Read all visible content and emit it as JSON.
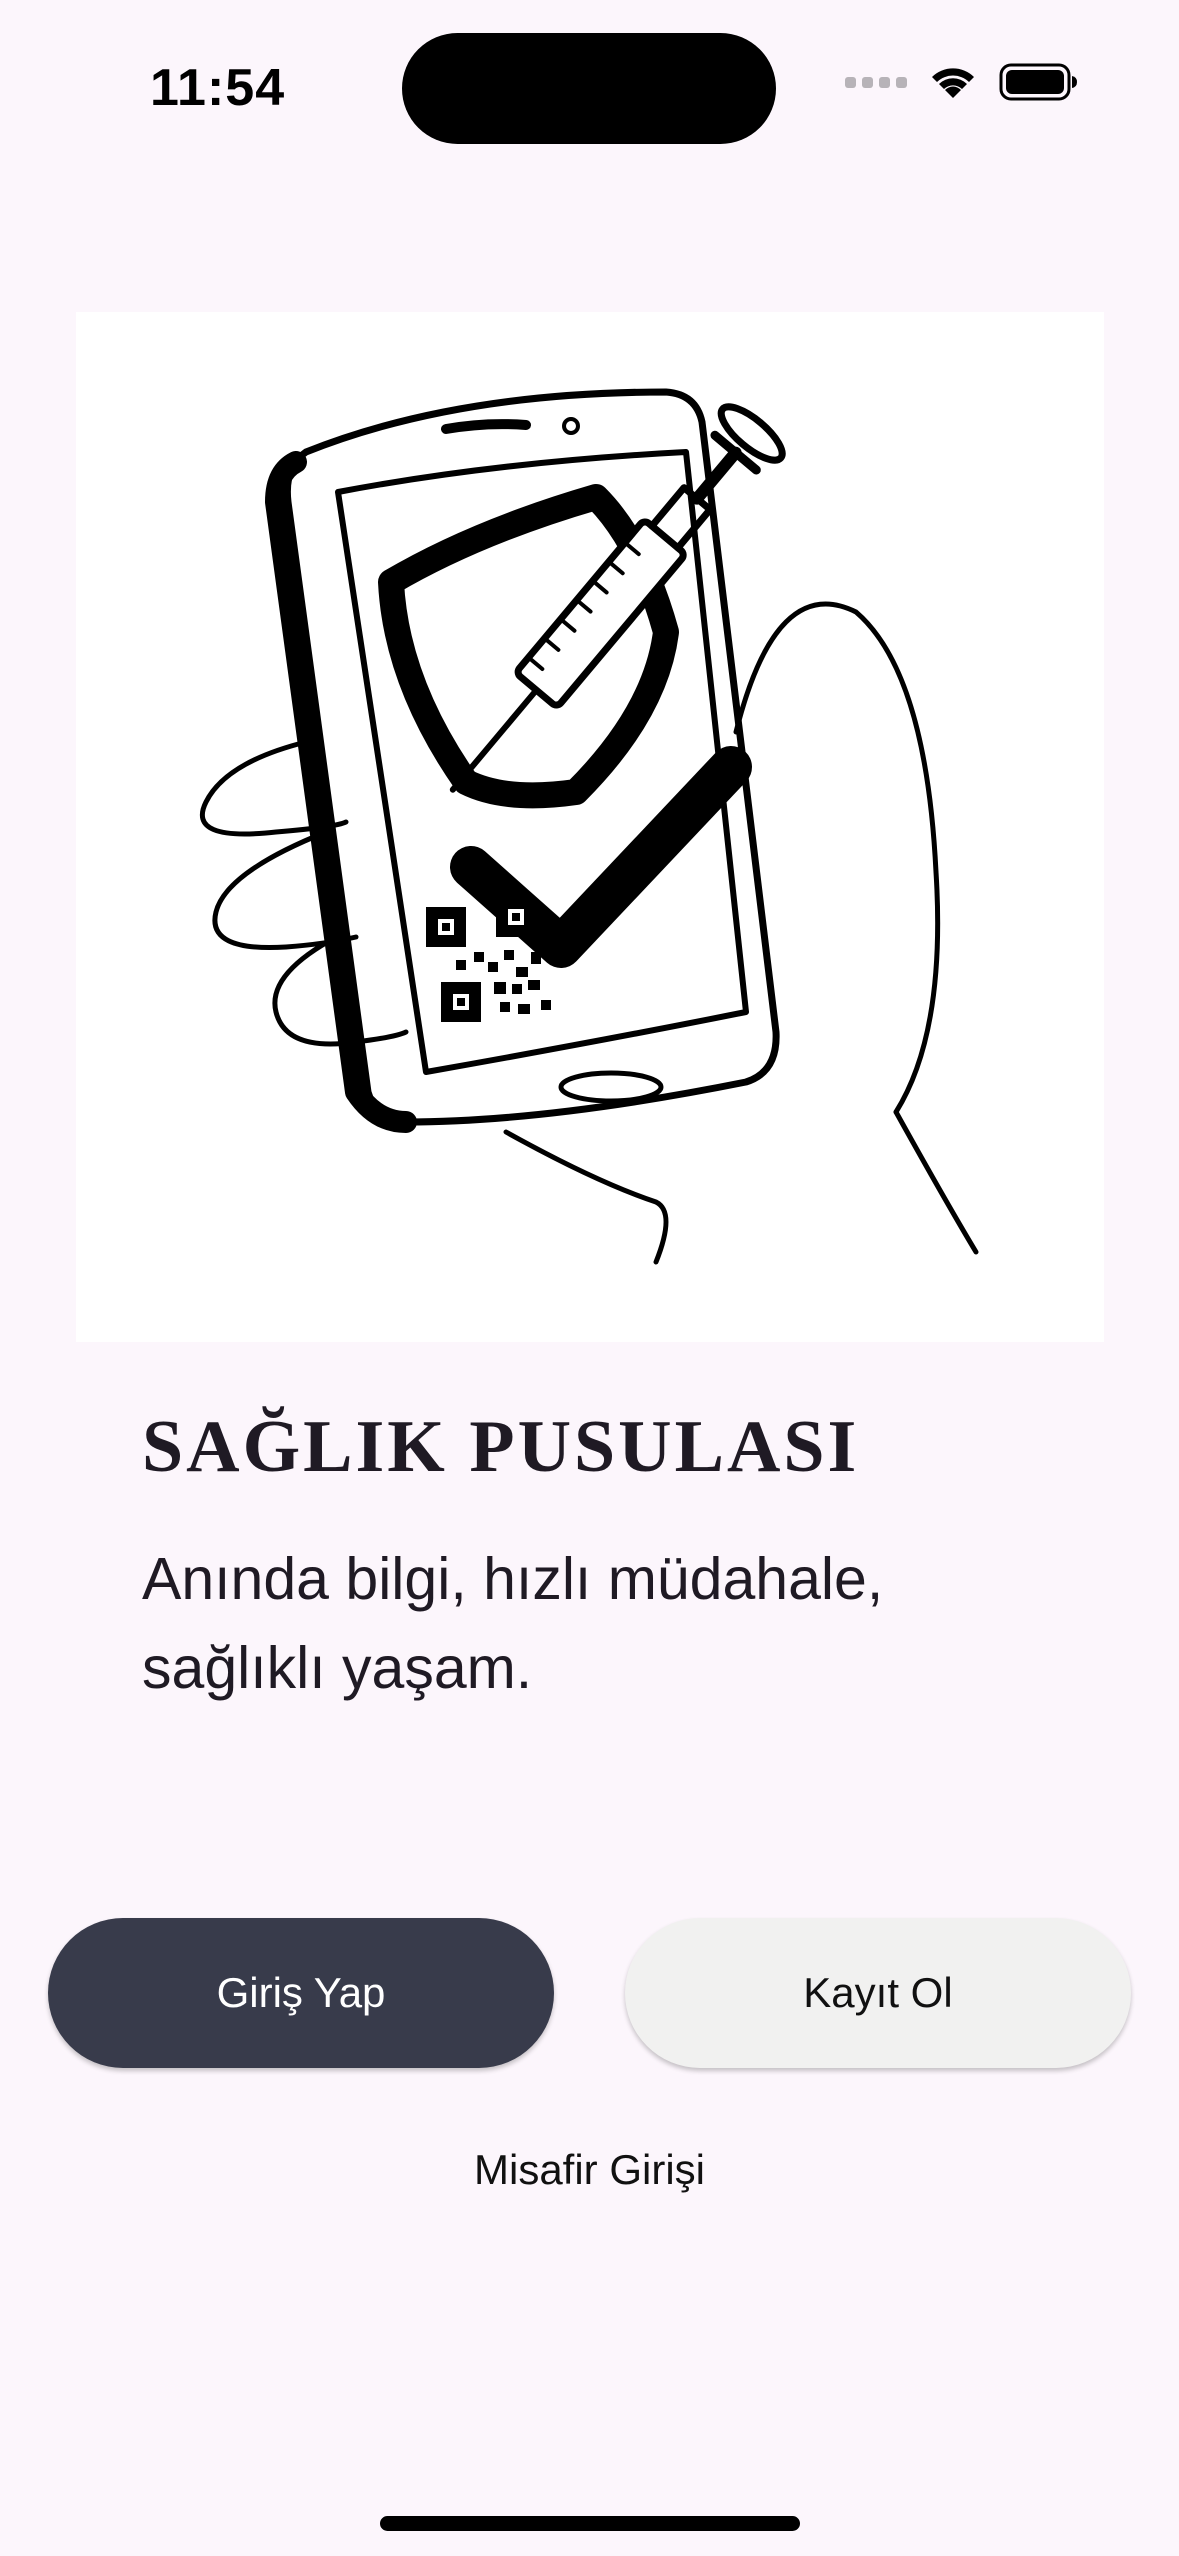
{
  "status_bar": {
    "time": "11:54",
    "icons": [
      "signal-icon",
      "wifi-icon",
      "battery-icon"
    ]
  },
  "hero": {
    "icon": "phone-vaccine-qr-checkmark-illustration"
  },
  "app": {
    "title": "SAĞLIK PUSULASI",
    "tagline": "Anında bilgi, hızlı müdahale, sağlıklı yaşam."
  },
  "actions": {
    "login_label": "Giriş Yap",
    "register_label": "Kayıt Ol",
    "guest_label": "Misafir Girişi"
  },
  "colors": {
    "background": "#fcf6fc",
    "login_button": "#383b4b",
    "register_button": "#f1f1f0",
    "text": "#1f1a24"
  }
}
